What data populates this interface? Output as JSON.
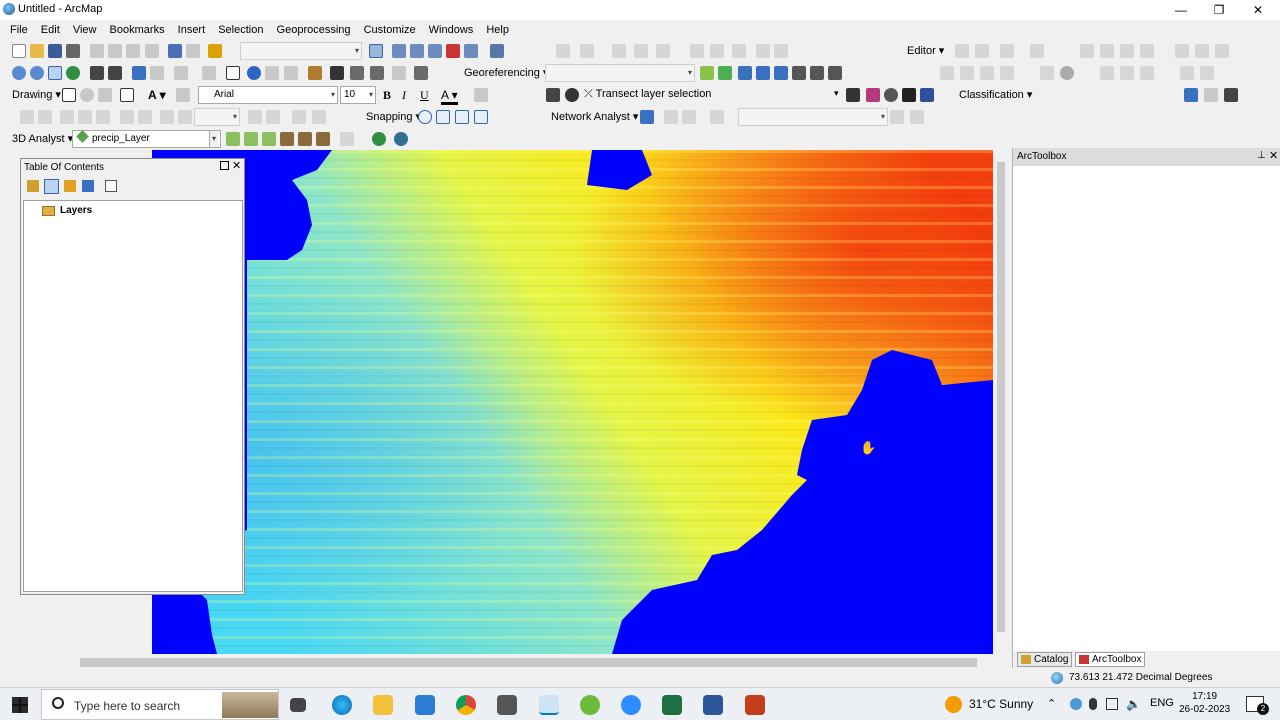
{
  "window": {
    "title": "Untitled - ArcMap",
    "minimize": "—",
    "maximize": "❐",
    "close": "✕"
  },
  "menu": [
    "File",
    "Edit",
    "View",
    "Bookmarks",
    "Insert",
    "Selection",
    "Geoprocessing",
    "Customize",
    "Windows",
    "Help"
  ],
  "toolbars": {
    "editor_label": "Editor",
    "georeferencing_label": "Georeferencing",
    "drawing_label": "Drawing",
    "font_name": "Arial",
    "font_size": "10",
    "bold": "B",
    "italic": "I",
    "underline": "U",
    "text_tool": "A",
    "transect_label": "Transect layer selection",
    "classification_label": "Classification",
    "snapping_label": "Snapping",
    "network_analyst_label": "Network Analyst",
    "analyst3d_label": "3D Analyst",
    "layer_combo": "precip_Layer"
  },
  "toc": {
    "title": "Table Of Contents",
    "root_layer": "Layers"
  },
  "toolbox": {
    "title": "ArcToolbox",
    "tab_catalog": "Catalog",
    "tab_toolbox": "ArcToolbox"
  },
  "status": {
    "coordinates": "73.613  21.472 Decimal Degrees"
  },
  "taskbar": {
    "search_placeholder": "Type here to search",
    "weather": "31°C  Sunny",
    "language": "ENG",
    "time": "17:19",
    "date": "26-02-2023",
    "notification_count": "2"
  },
  "colors": {
    "nodata": "#0000ff",
    "low": "#3fd6f2",
    "mid": "#f7f51e",
    "high": "#f23c0c"
  }
}
